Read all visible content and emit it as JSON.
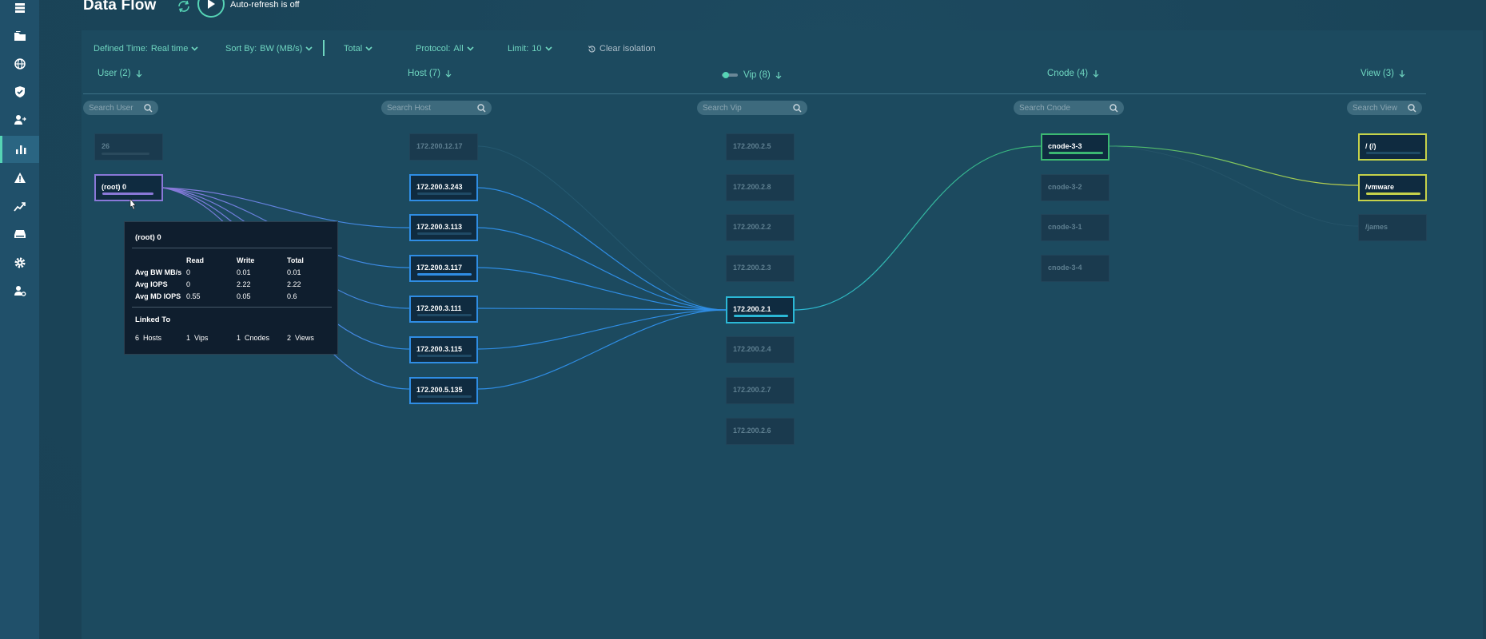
{
  "page": {
    "title": "Data Flow",
    "autorefresh_text": "Auto-refresh is off"
  },
  "sidebar": {
    "items": [
      {
        "icon": "stack-icon"
      },
      {
        "icon": "folder-icon"
      },
      {
        "icon": "globe-icon"
      },
      {
        "icon": "shield-icon"
      },
      {
        "icon": "user-transfer-icon"
      },
      {
        "icon": "bar-chart-icon",
        "active": true
      },
      {
        "icon": "warning-icon"
      },
      {
        "icon": "trend-icon"
      },
      {
        "icon": "drive-icon"
      },
      {
        "icon": "gear-icon"
      },
      {
        "icon": "user-settings-icon"
      }
    ]
  },
  "filters": {
    "defined_time_label": "Defined Time:",
    "defined_time_value": "Real time",
    "sort_by_label": "Sort By:",
    "sort_by_value": "BW (MB/s)",
    "total_label": "Total",
    "protocol_label": "Protocol:",
    "protocol_value": "All",
    "limit_label": "Limit:",
    "limit_value": "10",
    "clear_isolation": "Clear isolation"
  },
  "columns": {
    "user": "User (2)",
    "host": "Host (7)",
    "vip": "Vip (8)",
    "cnode": "Cnode (4)",
    "view": "View (3)"
  },
  "search": {
    "user": "Search User",
    "host": "Search Host",
    "vip": "Search Vip",
    "cnode": "Search Cnode",
    "view": "Search View"
  },
  "users": [
    "26",
    "(root) 0"
  ],
  "hosts": [
    "172.200.12.17",
    "172.200.3.243",
    "172.200.3.113",
    "172.200.3.117",
    "172.200.3.111",
    "172.200.3.115",
    "172.200.5.135"
  ],
  "vips": [
    "172.200.2.5",
    "172.200.2.8",
    "172.200.2.2",
    "172.200.2.3",
    "172.200.2.1",
    "172.200.2.4",
    "172.200.2.7",
    "172.200.2.6"
  ],
  "cnodes": [
    "cnode-3-3",
    "cnode-3-2",
    "cnode-3-1",
    "cnode-3-4"
  ],
  "views": [
    "/ (/)",
    "/vmware",
    "/james"
  ],
  "tooltip": {
    "title": "(root) 0",
    "headers": [
      "Read",
      "Write",
      "Total"
    ],
    "rows": [
      {
        "label": "Avg BW MB/s",
        "read": "0",
        "write": "0.01",
        "total": "0.01"
      },
      {
        "label": "Avg IOPS",
        "read": "0",
        "write": "2.22",
        "total": "2.22"
      },
      {
        "label": "Avg MD IOPS",
        "read": "0.55",
        "write": "0.05",
        "total": "0.6"
      }
    ],
    "linked_title": "Linked To",
    "linked": {
      "hosts_count": "6",
      "hosts_label": "Hosts",
      "vips_count": "1",
      "vips_label": "Vips",
      "cnodes_count": "1",
      "cnodes_label": "Cnodes",
      "views_count": "2",
      "views_label": "Views"
    }
  },
  "colors": {
    "accent": "#56d4b5",
    "user_border": "#8a78d8",
    "host_border": "#2f8de4",
    "vip_border": "#2bb8d6",
    "cnode_border": "#3bb872",
    "view_border": "#c6d24a"
  }
}
